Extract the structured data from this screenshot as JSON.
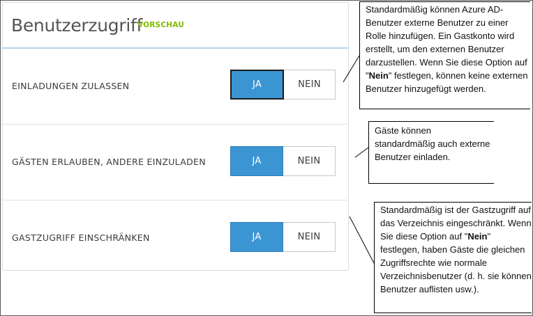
{
  "header": {
    "title": "Benutzerzugriff",
    "badge": "VORSCHAU"
  },
  "settings": [
    {
      "label": "EINLADUNGEN ZULASSEN",
      "yes_label": "JA",
      "no_label": "NEIN",
      "selected": "JA"
    },
    {
      "label": "GÄSTEN ERLAUBEN, ANDERE EINZULADEN",
      "yes_label": "JA",
      "no_label": "NEIN",
      "selected": "JA"
    },
    {
      "label": "GASTZUGRIFF EINSCHRÄNKEN",
      "yes_label": "JA",
      "no_label": "NEIN",
      "selected": "JA"
    }
  ],
  "callouts": {
    "invitations": {
      "before": "Standardmäßig können Azure AD-Benutzer externe Benutzer zu einer Rolle hinzufügen. Ein Gastkonto wird erstellt, um den externen Benutzer darzustellen. Wenn Sie diese Option auf \"",
      "bold": "Nein",
      "after": "\" festlegen, können keine externen Benutzer hinzugefügt werden."
    },
    "guest_invite": {
      "text": "Gäste können standardmäßig auch externe Benutzer einladen."
    },
    "guest_access": {
      "before": "Standardmäßig ist der Gastzugriff auf das Verzeichnis eingeschränkt. Wenn Sie diese Option auf \"",
      "bold": "Nein",
      "after": "\" festlegen, haben Gäste die gleichen Zugriffsrechte wie normale Verzeichnisbenutzer (d. h. sie können Benutzer auflisten usw.)."
    }
  },
  "colors": {
    "toggle_on": "#3c95d3",
    "badge": "#7fba00",
    "header_rule": "#b9d2e6"
  }
}
